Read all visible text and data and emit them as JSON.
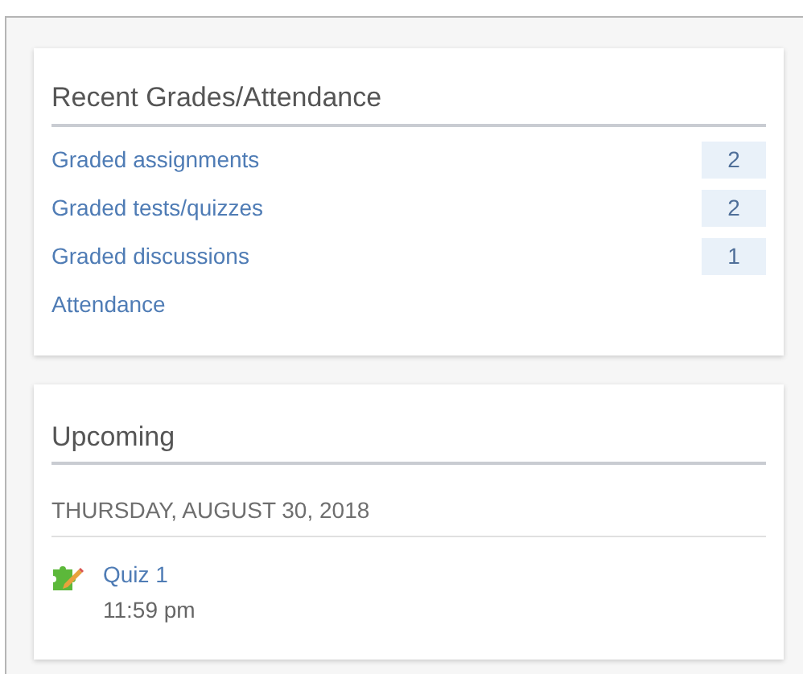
{
  "grades": {
    "title": "Recent Grades/Attendance",
    "items": [
      {
        "label": "Graded assignments",
        "count": "2"
      },
      {
        "label": "Graded tests/quizzes",
        "count": "2"
      },
      {
        "label": "Graded discussions",
        "count": "1"
      },
      {
        "label": "Attendance"
      }
    ]
  },
  "upcoming": {
    "title": "Upcoming",
    "date": "THURSDAY, AUGUST 30, 2018",
    "events": [
      {
        "title": "Quiz 1",
        "time": "11:59 pm"
      }
    ]
  }
}
